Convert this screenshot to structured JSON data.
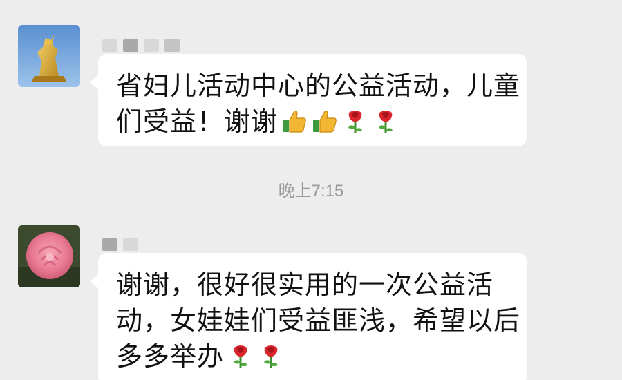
{
  "timestamp": "晚上7:15",
  "messages": [
    {
      "lines": [
        "省妇儿活动中心的公益活动，儿童",
        "们受益！谢谢"
      ],
      "emoji": [
        "thumbs-up",
        "thumbs-up",
        "rose",
        "rose"
      ]
    },
    {
      "lines": [
        "谢谢，很好很实用的一次公益活",
        "动，女娃娃们受益匪浅，希望以后",
        "多多举办"
      ],
      "emoji": [
        "rose",
        "rose"
      ]
    }
  ],
  "avatars": [
    {
      "name": "golden-statue-avatar"
    },
    {
      "name": "pink-rose-avatar"
    }
  ],
  "colors": {
    "background": "#ededed",
    "bubble": "#ffffff",
    "timestamp": "#9a9a9a"
  }
}
